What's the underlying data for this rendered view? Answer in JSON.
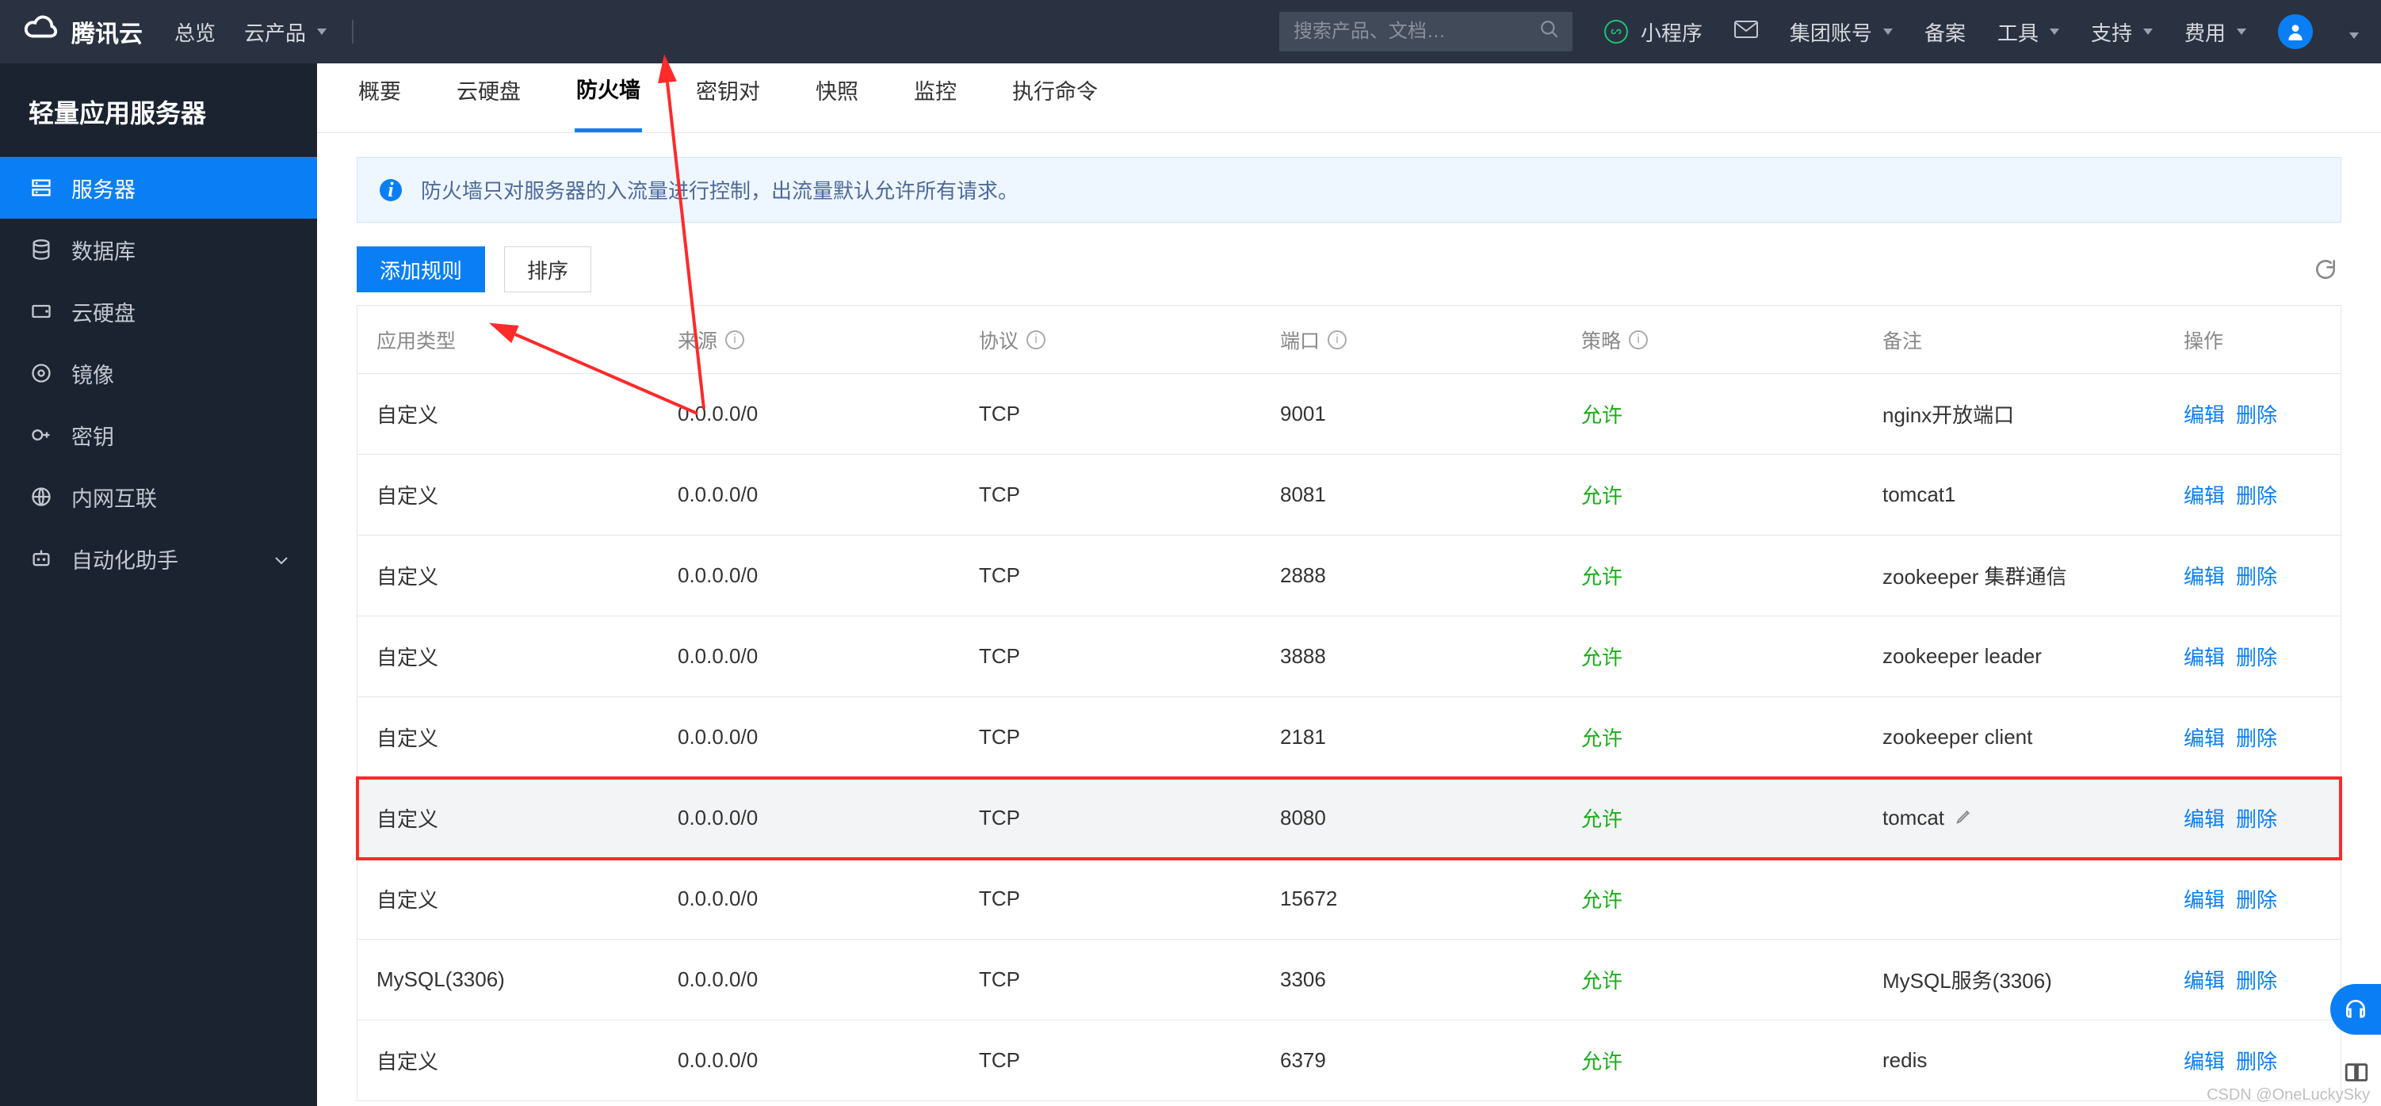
{
  "topbar": {
    "brand": "腾讯云",
    "links_left": [
      "总览",
      "云产品"
    ],
    "search_placeholder": "搜索产品、文档…",
    "miniprogram": "小程序",
    "links_right": [
      "集团账号",
      "备案",
      "工具",
      "支持",
      "费用"
    ]
  },
  "sidebar": {
    "product_title": "轻量应用服务器",
    "items": [
      {
        "label": "服务器",
        "icon": "server"
      },
      {
        "label": "数据库",
        "icon": "db"
      },
      {
        "label": "云硬盘",
        "icon": "disk"
      },
      {
        "label": "镜像",
        "icon": "image"
      },
      {
        "label": "密钥",
        "icon": "key"
      },
      {
        "label": "内网互联",
        "icon": "network"
      },
      {
        "label": "自动化助手",
        "icon": "robot"
      }
    ],
    "active_index": 0
  },
  "tabs": {
    "items": [
      "概要",
      "云硬盘",
      "防火墙",
      "密钥对",
      "快照",
      "监控",
      "执行命令"
    ],
    "active_index": 2
  },
  "banner": {
    "text": "防火墙只对服务器的入流量进行控制，出流量默认允许所有请求。"
  },
  "toolbar": {
    "add_rule": "添加规则",
    "sort": "排序"
  },
  "table": {
    "headers": {
      "app_type": "应用类型",
      "source": "来源",
      "protocol": "协议",
      "port": "端口",
      "policy": "策略",
      "remark": "备注",
      "action": "操作"
    },
    "actions": {
      "edit": "编辑",
      "delete": "删除"
    },
    "help_cols": [
      "source",
      "protocol",
      "port",
      "policy"
    ],
    "policy_allow_label": "允许",
    "rows": [
      {
        "app_type": "自定义",
        "source": "0.0.0.0/0",
        "protocol": "TCP",
        "port": "9001",
        "policy": "允许",
        "remark": "nginx开放端口"
      },
      {
        "app_type": "自定义",
        "source": "0.0.0.0/0",
        "protocol": "TCP",
        "port": "8081",
        "policy": "允许",
        "remark": "tomcat1"
      },
      {
        "app_type": "自定义",
        "source": "0.0.0.0/0",
        "protocol": "TCP",
        "port": "2888",
        "policy": "允许",
        "remark": "zookeeper 集群通信"
      },
      {
        "app_type": "自定义",
        "source": "0.0.0.0/0",
        "protocol": "TCP",
        "port": "3888",
        "policy": "允许",
        "remark": "zookeeper leader"
      },
      {
        "app_type": "自定义",
        "source": "0.0.0.0/0",
        "protocol": "TCP",
        "port": "2181",
        "policy": "允许",
        "remark": "zookeeper client"
      },
      {
        "app_type": "自定义",
        "source": "0.0.0.0/0",
        "protocol": "TCP",
        "port": "8080",
        "policy": "允许",
        "remark": "tomcat",
        "highlight": true,
        "hover": true
      },
      {
        "app_type": "自定义",
        "source": "0.0.0.0/0",
        "protocol": "TCP",
        "port": "15672",
        "policy": "允许",
        "remark": ""
      },
      {
        "app_type": "MySQL(3306)",
        "source": "0.0.0.0/0",
        "protocol": "TCP",
        "port": "3306",
        "policy": "允许",
        "remark": "MySQL服务(3306)"
      },
      {
        "app_type": "自定义",
        "source": "0.0.0.0/0",
        "protocol": "TCP",
        "port": "6379",
        "policy": "允许",
        "remark": "redis"
      }
    ]
  },
  "watermark": "CSDN @OneLuckySky"
}
